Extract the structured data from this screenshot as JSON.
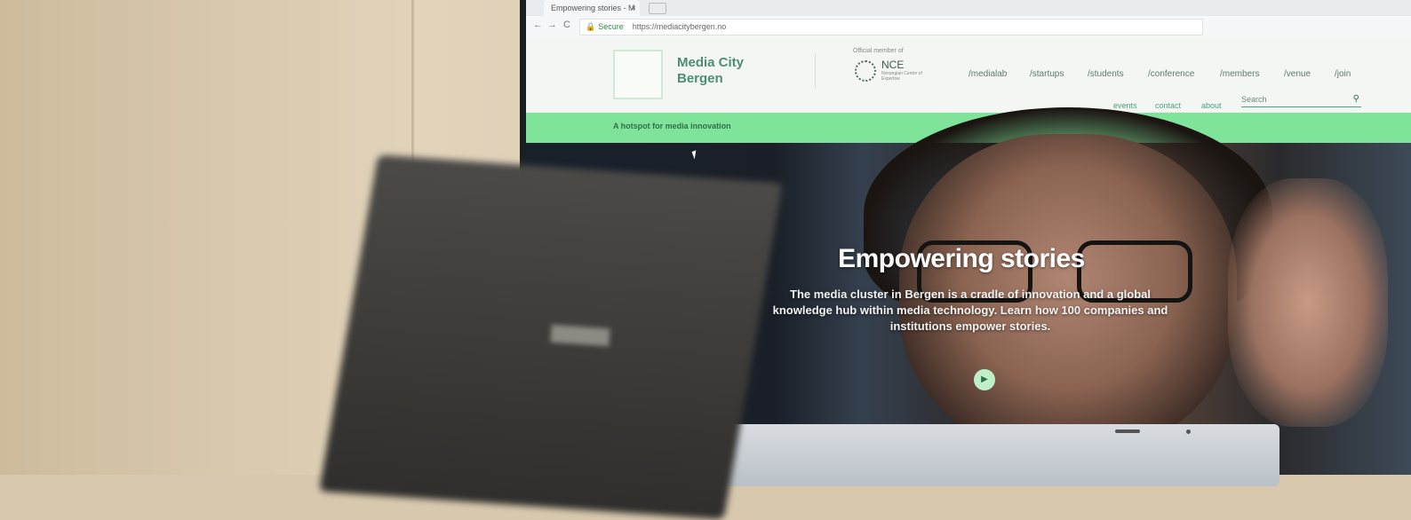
{
  "browser": {
    "tab_title": "Empowering stories - M",
    "tab_close": "×",
    "back": "←",
    "forward": "→",
    "reload": "C",
    "secure_label": "Secure",
    "url": "https://mediacitybergen.no"
  },
  "site": {
    "logo_line1": "Media City",
    "logo_line2": "Bergen",
    "nce_caption": "Official member of",
    "nce_title": "NCE",
    "nce_sub": "Norwegian Centre of Expertise",
    "main_nav": [
      "/medialab",
      "/startups",
      "/students",
      "/conference",
      "/members",
      "/venue",
      "/join"
    ],
    "sub_nav": [
      "events",
      "contact",
      "about"
    ],
    "search_placeholder": "Search",
    "tagline": "A hotspot for media innovation"
  },
  "hero": {
    "title": "Empowering stories",
    "body": "The media cluster in Bergen is a cradle of innovation and a global knowledge hub within media technology. Learn how 100 companies and institutions empower stories.",
    "play_icon": "▶"
  },
  "colors": {
    "accent_green": "#7fe39a",
    "logo_green": "#4a8f72"
  }
}
